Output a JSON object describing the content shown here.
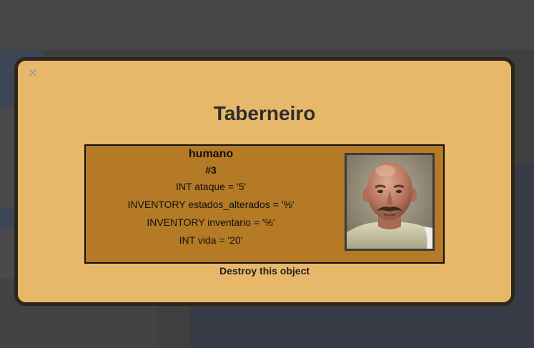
{
  "modal": {
    "close_symbol": "×",
    "title": "Taberneiro",
    "destroy_label": "Destroy this object"
  },
  "card": {
    "type": "humano",
    "id": "#3",
    "attributes": [
      "INT ataque = '5'",
      "INVENTORY estados_alterados = '%'",
      "INVENTORY inventario = '%'",
      "INT vida = '20'"
    ],
    "portrait": "bald-mustached-man-portrait"
  },
  "colors": {
    "modal_bg": "#e8b86a",
    "card_bg": "#b47a25",
    "modal_border": "#2e2619"
  }
}
